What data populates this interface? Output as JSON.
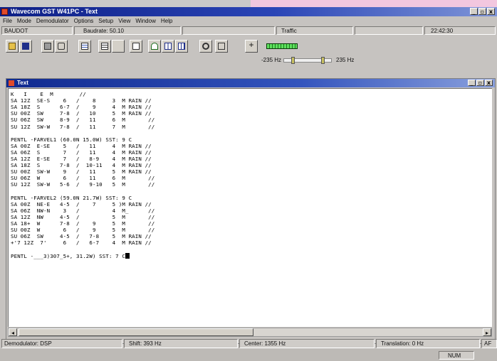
{
  "window": {
    "title": "Wavecom GST W41PC - Text",
    "buttons": [
      "_",
      "▫",
      "x"
    ]
  },
  "menu": [
    "File",
    "Mode",
    "Demodulator",
    "Options",
    "Setup",
    "View",
    "Window",
    "Help"
  ],
  "status_top": {
    "mode": "BAUDOT",
    "baudrate": "Baudrate: 50.10",
    "traffic": "Traffic",
    "time": "22:42:30"
  },
  "tuning": {
    "low": "-235 Hz",
    "high": "235 Hz",
    "marker_a_pct": 18,
    "marker_b_pct": 82
  },
  "text_window": {
    "title": "Text",
    "buttons": [
      "_",
      "▫",
      "x"
    ],
    "lines": [
      "K   I    E  M        //",
      "SA 12Z  SE-S    6   /    8     3  M RAIN //",
      "SA 18Z  S      6-7  /    9     4  M RAIN //",
      "SU 00Z  SW     7-8  /   10     5  M RAIN //",
      "SU 06Z  SW     8-9  /   11     6  M       //",
      "SU 12Z  SW-W   7-8  /   11     7  M       //",
      "",
      "PENTL -FARVEL1 (60.0N 15.0W) SST: 9 C",
      "SA 00Z  E-SE    5   /   11     4  M RAIN //",
      "SA 06Z  S       7   /   11     4  M RAIN //",
      "SA 12Z  E-SE    7   /   8-9    4  M RAIN //",
      "SA 18Z  S      7-8  /  10-11   4  M RAIN //",
      "SU 00Z  SW-W    9   /   11     5  M RAIN //",
      "SU 06Z  W       6   /   11     6  M       //",
      "SU 12Z  SW-W   5-6  /   9-10   5  M       //",
      "",
      "PENTL -FARVEL2 (59.0N 21.7W) SST: 9 C",
      "SA 00Z  NE-E   4-5  /    7     5 )M RAIN //",
      "SA 06Z  NW-N    3   /          4  M_      //",
      "SA 12Z  NW     4-5  /          5  M       //",
      "SA 18+  W      7-8  /    9     5  M       //",
      "SU 00Z  W       6   /    9     5  M       //",
      "SU 06Z  SW     4-5  /   7-8    5  M RAIN //",
      "+'7 12Z  7'     6   /   6-7    4  M RAIN //",
      "",
      "PENTL -___3)307_5+, 31.2W) SST: 7 C"
    ]
  },
  "status_bottom": {
    "demodulator": "Demodulator: DSP",
    "shift": "Shift: 393 Hz",
    "center": "Center: 1355 Hz",
    "translation": "Translation: 0 Hz",
    "af": "AF",
    "num": "NUM"
  },
  "colors": {
    "title_bar": "#0d1f86",
    "level_meter": "#1a7a1a",
    "desktop_pink": "#f2c7df"
  }
}
